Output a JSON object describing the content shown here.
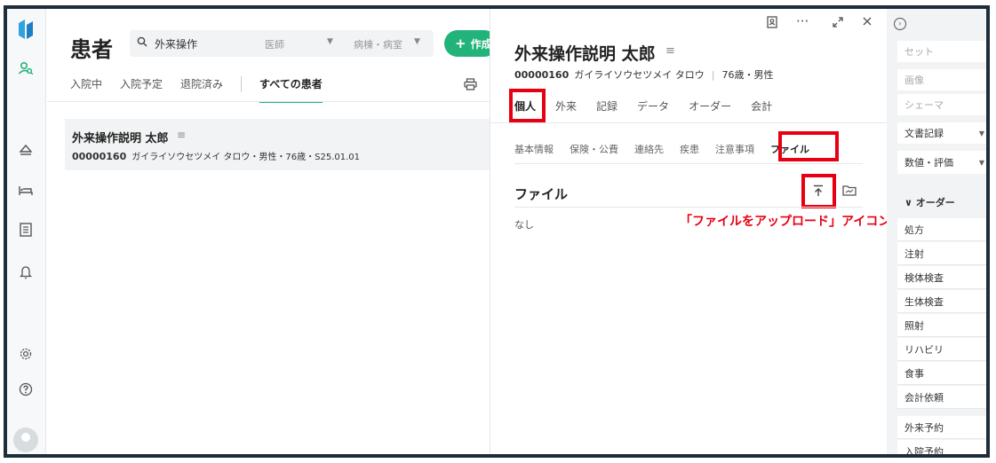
{
  "rail": {
    "icons": [
      "logo-icon",
      "patient-search-icon",
      "eject-icon",
      "bed-icon",
      "list-icon",
      "bell-icon",
      "gear-icon",
      "help-icon",
      "avatar"
    ]
  },
  "list": {
    "title": "患者",
    "search_value": "外来操作",
    "filter_doctor": "医師",
    "filter_ward": "病棟・病室",
    "create_label": "作成",
    "tabs": [
      "入院中",
      "入院予定",
      "退院済み",
      "すべての患者"
    ],
    "active_tab": "すべての患者",
    "patient": {
      "name": "外来操作説明 太郎",
      "id": "00000160",
      "meta": "ガイライソウセツメイ タロウ・男性・76歳・S25.01.01"
    }
  },
  "detail": {
    "name": "外来操作説明 太郎",
    "id": "00000160",
    "kana": "ガイライソウセツメイ タロウ",
    "age_sex": "76歳・男性",
    "tabs": [
      "個人",
      "外来",
      "記録",
      "データ",
      "オーダー",
      "会計"
    ],
    "active_tab": "個人",
    "subtabs": [
      "基本情報",
      "保険・公費",
      "連絡先",
      "疾患",
      "注意事項",
      "ファイル"
    ],
    "active_subtab": "ファイル",
    "section_title": "ファイル",
    "empty_text": "なし",
    "annotation": "「ファイルをアップロード」アイコン",
    "highlight_color": "#e60012"
  },
  "sidebar": {
    "set": "セット",
    "image": "画像",
    "schema": "シェーマ",
    "doc": "文書記録",
    "eval": "数値・評価",
    "order_head": "オーダー",
    "orders": [
      "処方",
      "注射",
      "検体検査",
      "生体検査",
      "照射",
      "リハビリ",
      "食事",
      "会計依頼"
    ],
    "bottom": [
      "外来予約",
      "入院予約"
    ]
  },
  "colors": {
    "accent": "#22b37a",
    "annotation": "#e60012"
  }
}
